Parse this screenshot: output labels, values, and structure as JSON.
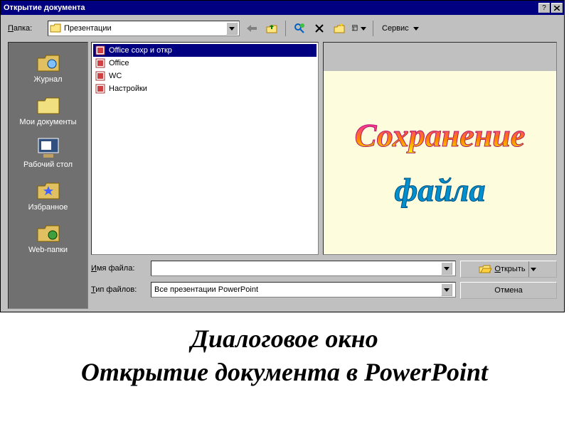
{
  "titlebar": {
    "title": "Открытие документа"
  },
  "toolbar": {
    "folder_label": "Папка:",
    "current_folder": "Презентации",
    "tools_label": "Сервис"
  },
  "sidebar": {
    "items": [
      {
        "label": "Журнал"
      },
      {
        "label": "Мои документы"
      },
      {
        "label": "Рабочий стол"
      },
      {
        "label": "Избранное"
      },
      {
        "label": "Web-папки"
      }
    ]
  },
  "filelist": {
    "items": [
      {
        "name": "Office сохр и откр",
        "selected": true
      },
      {
        "name": "Office",
        "selected": false
      },
      {
        "name": "WC",
        "selected": false
      },
      {
        "name": "Настройки",
        "selected": false
      }
    ]
  },
  "preview": {
    "line1": "Сохранение",
    "line2": "файла"
  },
  "fields": {
    "name_label": "Имя файла:",
    "name_value": "",
    "type_label": "Тип файлов:",
    "type_value": "Все презентации PowerPoint"
  },
  "buttons": {
    "open": "Открыть",
    "cancel": "Отмена"
  },
  "caption": {
    "line1": "Диалоговое окно",
    "line2": "Открытие документа в PowerPoint"
  }
}
